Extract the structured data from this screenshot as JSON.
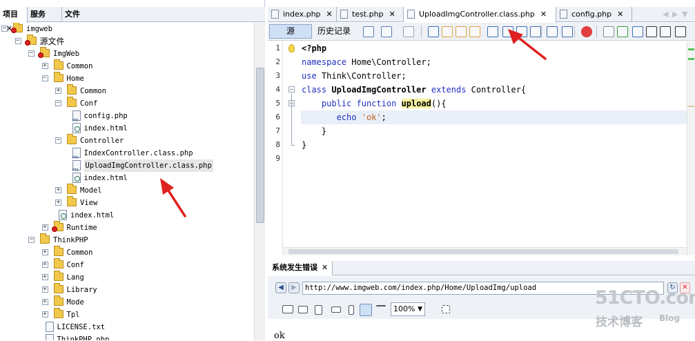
{
  "left_tabs": [
    {
      "label": "项目",
      "close": "✕"
    },
    {
      "label": "服务"
    },
    {
      "label": "文件"
    }
  ],
  "tree": [
    {
      "label": "imgweb",
      "depth": 0,
      "kind": "project",
      "expander": "−"
    },
    {
      "label": "源文件",
      "depth": 1,
      "kind": "folder-badge",
      "expander": "−",
      "cjk": true
    },
    {
      "label": "ImgWeb",
      "depth": 2,
      "kind": "folder-badge",
      "expander": "−"
    },
    {
      "label": "Common",
      "depth": 3,
      "kind": "folder",
      "expander": "+"
    },
    {
      "label": "Home",
      "depth": 3,
      "kind": "folder",
      "expander": "−"
    },
    {
      "label": "Common",
      "depth": 4,
      "kind": "folder",
      "expander": "+"
    },
    {
      "label": "Conf",
      "depth": 4,
      "kind": "folder",
      "expander": "−"
    },
    {
      "label": "config.php",
      "depth": 5,
      "kind": "php"
    },
    {
      "label": "index.html",
      "depth": 5,
      "kind": "html"
    },
    {
      "label": "Controller",
      "depth": 4,
      "kind": "folder",
      "expander": "−"
    },
    {
      "label": "IndexController.class.php",
      "depth": 5,
      "kind": "php"
    },
    {
      "label": "UploadImgController.class.php",
      "depth": 5,
      "kind": "php",
      "selected": true
    },
    {
      "label": "index.html",
      "depth": 5,
      "kind": "html"
    },
    {
      "label": "Model",
      "depth": 4,
      "kind": "folder",
      "expander": "+"
    },
    {
      "label": "View",
      "depth": 4,
      "kind": "folder",
      "expander": "+"
    },
    {
      "label": "index.html",
      "depth": 4,
      "kind": "html"
    },
    {
      "label": "Runtime",
      "depth": 3,
      "kind": "folder-badge",
      "expander": "+"
    },
    {
      "label": "ThinkPHP",
      "depth": 2,
      "kind": "folder",
      "expander": "−"
    },
    {
      "label": "Common",
      "depth": 3,
      "kind": "folder",
      "expander": "+"
    },
    {
      "label": "Conf",
      "depth": 3,
      "kind": "folder",
      "expander": "+"
    },
    {
      "label": "Lang",
      "depth": 3,
      "kind": "folder",
      "expander": "+"
    },
    {
      "label": "Library",
      "depth": 3,
      "kind": "folder",
      "expander": "+"
    },
    {
      "label": "Mode",
      "depth": 3,
      "kind": "folder",
      "expander": "+"
    },
    {
      "label": "Tpl",
      "depth": 3,
      "kind": "folder",
      "expander": "+"
    },
    {
      "label": "LICENSE.txt",
      "depth": 3,
      "kind": "txt"
    },
    {
      "label": "ThinkPHP.php",
      "depth": 3,
      "kind": "php"
    }
  ],
  "editor_tabs": [
    {
      "label": "index.php",
      "close": "✕"
    },
    {
      "label": "test.php",
      "close": "✕"
    },
    {
      "label": "UploadImgController.class.php",
      "close": "✕",
      "active": true
    },
    {
      "label": "config.php",
      "close": "✕"
    }
  ],
  "editor_tab_nav": {
    "prev": "◀",
    "next": "▶",
    "menu": "▼",
    "restore": "▭"
  },
  "toolbar": {
    "source_label": "源",
    "history_label": "历史记录"
  },
  "code_lines": [
    {
      "num": "1",
      "parts": [
        {
          "t": "<?php",
          "c": "bold"
        }
      ]
    },
    {
      "num": "2",
      "parts": [
        {
          "t": "namespace",
          "c": "kw"
        },
        {
          "t": " Home\\Controller;",
          "c": ""
        }
      ]
    },
    {
      "num": "3",
      "parts": [
        {
          "t": "use",
          "c": "kw"
        },
        {
          "t": " Think\\Controller;",
          "c": ""
        }
      ]
    },
    {
      "num": "4",
      "parts": [
        {
          "t": "class",
          "c": "kw"
        },
        {
          "t": " ",
          "c": ""
        },
        {
          "t": "UploadImgController",
          "c": "bold"
        },
        {
          "t": " ",
          "c": ""
        },
        {
          "t": "extends",
          "c": "kw"
        },
        {
          "t": " Controller{",
          "c": ""
        }
      ]
    },
    {
      "num": "5",
      "parts": [
        {
          "t": "    ",
          "c": ""
        },
        {
          "t": "public",
          "c": "kw"
        },
        {
          "t": " ",
          "c": ""
        },
        {
          "t": "function",
          "c": "kw"
        },
        {
          "t": " ",
          "c": ""
        },
        {
          "t": "upload",
          "c": "hlfn"
        },
        {
          "t": "(){",
          "c": ""
        }
      ]
    },
    {
      "num": "6",
      "parts": [
        {
          "t": "       ",
          "c": ""
        },
        {
          "t": "echo",
          "c": "kw"
        },
        {
          "t": " ",
          "c": ""
        },
        {
          "t": "'ok'",
          "c": "str"
        },
        {
          "t": ";",
          "c": ""
        }
      ]
    },
    {
      "num": "7",
      "parts": [
        {
          "t": "    }",
          "c": ""
        }
      ]
    },
    {
      "num": "8",
      "parts": [
        {
          "t": "}",
          "c": ""
        }
      ]
    },
    {
      "num": "9",
      "parts": []
    }
  ],
  "output": {
    "tab_label": "系统发生错误",
    "tab_close": "✕",
    "url": "http://www.imgweb.com/index.php/Home/UploadImg/upload",
    "zoom": "100%",
    "zoom_arrow": "▼",
    "content": "ok",
    "back": "◀",
    "forward": "▶",
    "refresh": "↻",
    "stop": "✕"
  },
  "watermark": {
    "top": "51CTO.com",
    "bottom": "技术博客",
    "blog": "Blog"
  },
  "colors": {
    "accent": "#cfe0f5",
    "arrow": "#e02020",
    "tab_bar": "#eef1f6"
  }
}
